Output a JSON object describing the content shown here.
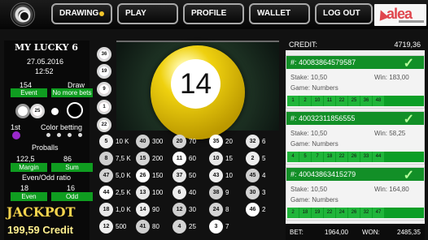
{
  "nav": {
    "drawing": "DRAWING",
    "play": "PLAY",
    "profile": "PROFILE",
    "wallet": "WALLET",
    "logout": "LOG OUT"
  },
  "logo": {
    "brand": "alea"
  },
  "draw": {
    "title": "MY LUCKY 6",
    "date": "27.05.2016",
    "time": "12:52",
    "event_number": "154",
    "event_label": "Event",
    "draw_label": "Draw",
    "draw_status": "No more bets",
    "first_label": "1st",
    "color_betting": "Color betting",
    "proballs": "Proballs",
    "margin_value": "122,5",
    "margin_label": "Margin",
    "sum_value": "86",
    "sum_label": "Sum",
    "even_odd_ratio": "Even/Odd ratio",
    "even_value": "18",
    "even_label": "Even",
    "odd_value": "16",
    "odd_label": "Odd",
    "jackpot": "JACKPOT",
    "jackpot_credit": "199,59 Credit"
  },
  "big_ball": {
    "number": "14",
    "color": "#f0d319"
  },
  "drawn_column": [
    "36",
    "19",
    "9",
    "1",
    "22"
  ],
  "proball_numbers": [
    "25"
  ],
  "stake_rows": [
    [
      "5",
      "10 K",
      "40",
      "300",
      "20",
      "70",
      "35",
      "20",
      "32",
      "6"
    ],
    [
      "8",
      "7,5 K",
      "15",
      "200",
      "11",
      "60",
      "10",
      "15",
      "2",
      "5"
    ],
    [
      "47",
      "5,0 K",
      "26",
      "150",
      "37",
      "50",
      "43",
      "10",
      "45",
      "4"
    ],
    [
      "44",
      "2,5 K",
      "13",
      "100",
      "6",
      "40",
      "38",
      "9",
      "30",
      "3"
    ],
    [
      "18",
      "1,0 K",
      "14",
      "90",
      "12",
      "30",
      "24",
      "8",
      "46",
      "2"
    ],
    [
      "12",
      "500",
      "41",
      "80",
      "4",
      "25",
      "3",
      "7",
      "",
      ""
    ]
  ],
  "right_panel": {
    "credit_label": "CREDIT:",
    "credit_value": "4719,36",
    "stake_label": "Stake:",
    "game_label": "Game:",
    "win_label": "Win:",
    "tickets": [
      {
        "id": "#: 40083864579587",
        "stake": "10,50",
        "win": "183,00",
        "game": "Numbers",
        "numbers": [
          "1",
          "2",
          "10",
          "11",
          "22",
          "25",
          "36",
          "48"
        ]
      },
      {
        "id": "#: 40032311856555",
        "stake": "10,50",
        "win": "58,25",
        "game": "Numbers",
        "numbers": [
          "4",
          "5",
          "7",
          "18",
          "22",
          "26",
          "33",
          "44"
        ]
      },
      {
        "id": "#: 40043863415279",
        "stake": "10,50",
        "win": "164,80",
        "game": "Numbers",
        "numbers": [
          "2",
          "18",
          "19",
          "22",
          "24",
          "26",
          "32",
          "47"
        ]
      }
    ],
    "bet_label": "BET:",
    "bet_value": "1964,00",
    "won_label": "WON:",
    "won_value": "2485,35"
  }
}
